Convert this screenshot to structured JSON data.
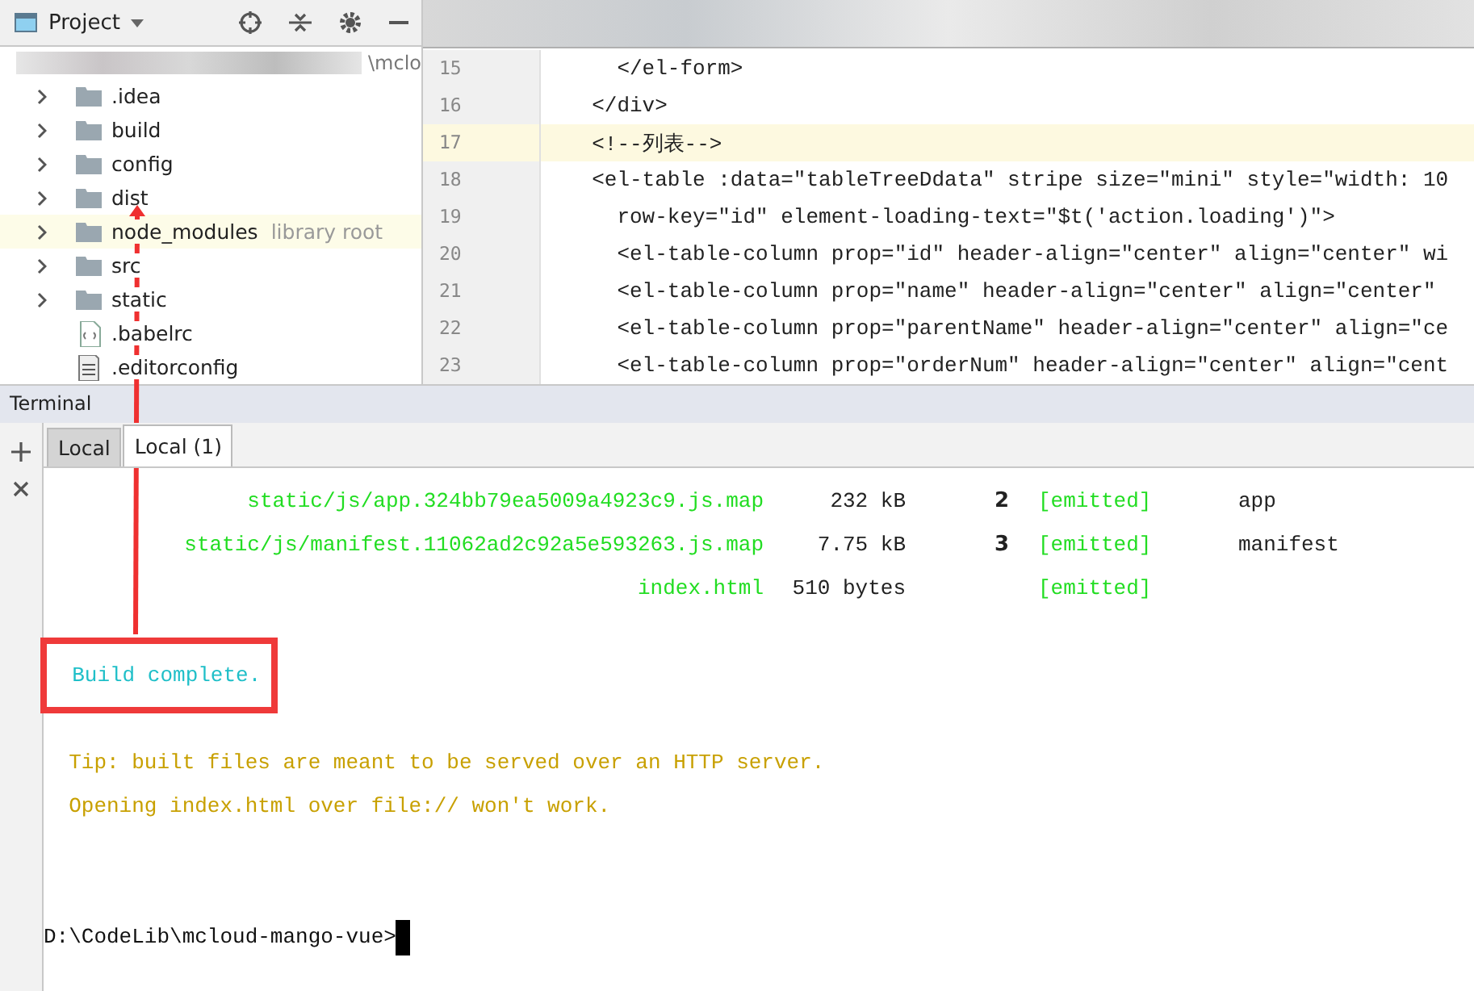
{
  "project_panel": {
    "title": "Project",
    "root_path": "\\mclo",
    "items": [
      {
        "label": ".idea",
        "kind": "folder",
        "selected": false
      },
      {
        "label": "build",
        "kind": "folder",
        "selected": false
      },
      {
        "label": "config",
        "kind": "folder",
        "selected": false
      },
      {
        "label": "dist",
        "kind": "folder",
        "selected": false,
        "pointed": true
      },
      {
        "label": "node_modules",
        "kind": "folder",
        "note": "library root",
        "selected": true
      },
      {
        "label": "src",
        "kind": "folder",
        "selected": false
      },
      {
        "label": "static",
        "kind": "folder",
        "selected": false
      },
      {
        "label": ".babelrc",
        "kind": "config-file",
        "selected": false
      },
      {
        "label": ".editorconfig",
        "kind": "text-file",
        "selected": false
      }
    ]
  },
  "editor": {
    "lines": [
      {
        "number": "15",
        "code": "    </el-form>",
        "current": false
      },
      {
        "number": "16",
        "code": "  </div>",
        "current": false
      },
      {
        "number": "17",
        "code": "  <!--列表-->",
        "current": true
      },
      {
        "number": "18",
        "code": "  <el-table :data=\"tableTreeDdata\" stripe size=\"mini\" style=\"width: 10",
        "current": false
      },
      {
        "number": "19",
        "code": "    row-key=\"id\" element-loading-text=\"$t('action.loading')\">",
        "current": false
      },
      {
        "number": "20",
        "code": "    <el-table-column prop=\"id\" header-align=\"center\" align=\"center\" wi",
        "current": false
      },
      {
        "number": "21",
        "code": "    <el-table-column prop=\"name\" header-align=\"center\" align=\"center\" ",
        "current": false
      },
      {
        "number": "22",
        "code": "    <el-table-column prop=\"parentName\" header-align=\"center\" align=\"ce",
        "current": false
      },
      {
        "number": "23",
        "code": "    <el-table-column prop=\"orderNum\" header-align=\"center\" align=\"cent",
        "current": false
      }
    ]
  },
  "terminal": {
    "title": "Terminal",
    "tabs": [
      {
        "label": "Local",
        "selected": false
      },
      {
        "label": "Local (1)",
        "selected": true
      }
    ],
    "lines": [
      {
        "kind": "asset",
        "file": "static/js/app.324bb79ea5009a4923c9.js.map",
        "size": "232 kB",
        "chunk": "2",
        "status": "[emitted]",
        "name": "app"
      },
      {
        "kind": "asset",
        "file": "static/js/manifest.11062ad2c92a5e593263.js.map",
        "size": "7.75 kB",
        "chunk": "3",
        "status": "[emitted]",
        "name": "manifest"
      },
      {
        "kind": "asset",
        "file": "index.html",
        "size": "510 bytes",
        "status": "[emitted]"
      },
      {
        "kind": "blank"
      },
      {
        "kind": "text",
        "text": "  Build complete.",
        "color": "#1fbfc8",
        "highlighted": true
      },
      {
        "kind": "blank"
      },
      {
        "kind": "text",
        "text": "  Tip: built files are meant to be served over an HTTP server.",
        "color": "#c8a000",
        "highlighted": false
      },
      {
        "kind": "text",
        "text": "  Opening index.html over file:// won't work.",
        "color": "#c8a000",
        "highlighted": false
      },
      {
        "kind": "blank"
      },
      {
        "kind": "blank"
      },
      {
        "kind": "prompt",
        "text": "D:\\CodeLib\\mcloud-mango-vue>"
      }
    ]
  }
}
